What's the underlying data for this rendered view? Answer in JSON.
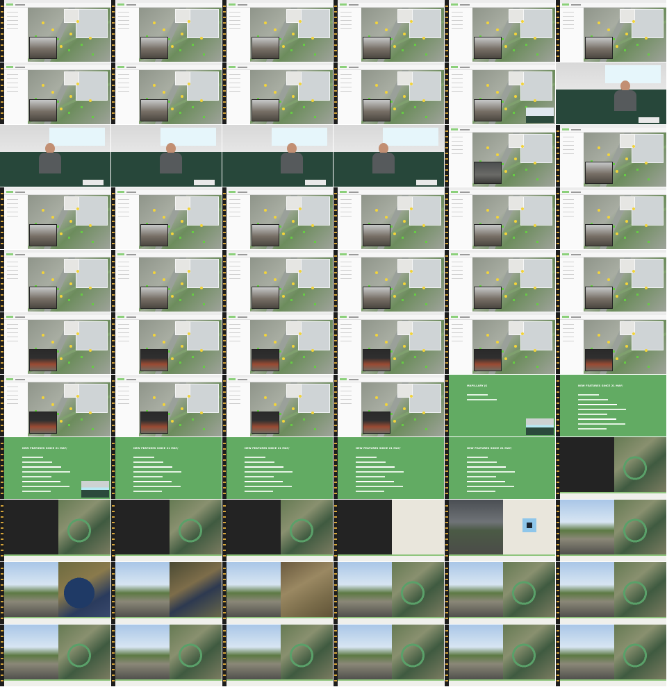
{
  "sheet": {
    "rows": 11,
    "cols": 6,
    "frames": [
      "map",
      "map",
      "map",
      "map",
      "map",
      "map",
      "map",
      "map",
      "map",
      "map",
      "map-speaker",
      "cam",
      "cam",
      "cam",
      "cam",
      "cam",
      "map-dark",
      "map",
      "map",
      "map",
      "map",
      "map",
      "map",
      "map",
      "map",
      "map",
      "map",
      "map",
      "map",
      "map",
      "map",
      "map",
      "map",
      "map",
      "map",
      "map",
      "map",
      "map",
      "map",
      "map",
      "slide-short",
      "slide",
      "slide-pip",
      "slide",
      "slide",
      "slide",
      "slide",
      "split",
      "split",
      "split",
      "split",
      "split-beige",
      "split-dusk",
      "split-street",
      "split-europe",
      "split-coast",
      "split-terrain",
      "split-street",
      "split-street",
      "split-street",
      "split-street",
      "split-street",
      "split-street",
      "split-street",
      "split-street",
      "split-street"
    ]
  },
  "slides": {
    "title": "NEW FEATURES SINCE 21 MAY/",
    "short_title": "MAPILLARY JS",
    "colors": {
      "background": "#62ab63",
      "text": "#ffffff"
    }
  },
  "colors": {
    "accent_yellow": "#f2d43a",
    "accent_green": "#66cc44",
    "dark_bar": "#1d1d1d"
  }
}
